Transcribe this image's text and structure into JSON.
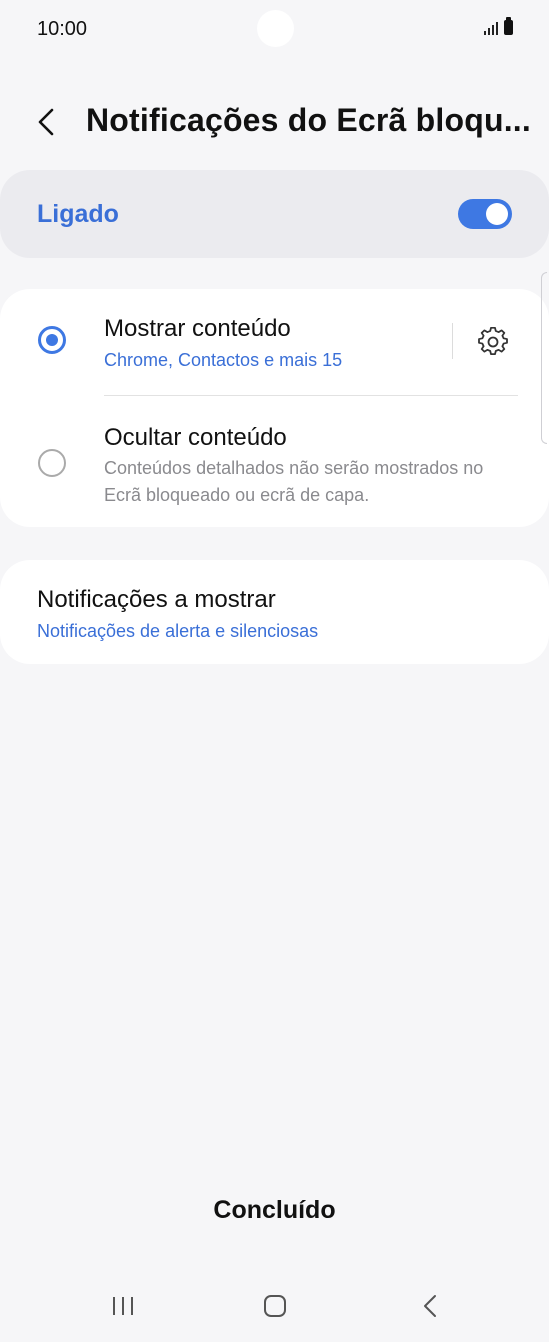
{
  "status_bar": {
    "time": "10:00"
  },
  "header": {
    "title": "Notificações do Ecrã bloqu..."
  },
  "master_switch": {
    "label": "Ligado",
    "state": "on"
  },
  "options": [
    {
      "title": "Mostrar conteúdo",
      "subtitle": "Chrome, Contactos e mais 15",
      "selected": true
    },
    {
      "title": "Ocultar conteúdo",
      "subtitle": "Conteúdos detalhados não serão mostrados no Ecrã bloqueado ou ecrã de capa.",
      "selected": false
    }
  ],
  "notifications_to_show": {
    "title": "Notificações a mostrar",
    "subtitle": "Notificações de alerta e silenciosas"
  },
  "footer": {
    "done_label": "Concluído"
  },
  "colors": {
    "accent": "#3e78e3",
    "background": "#f6f6f8",
    "card": "#ffffff"
  }
}
